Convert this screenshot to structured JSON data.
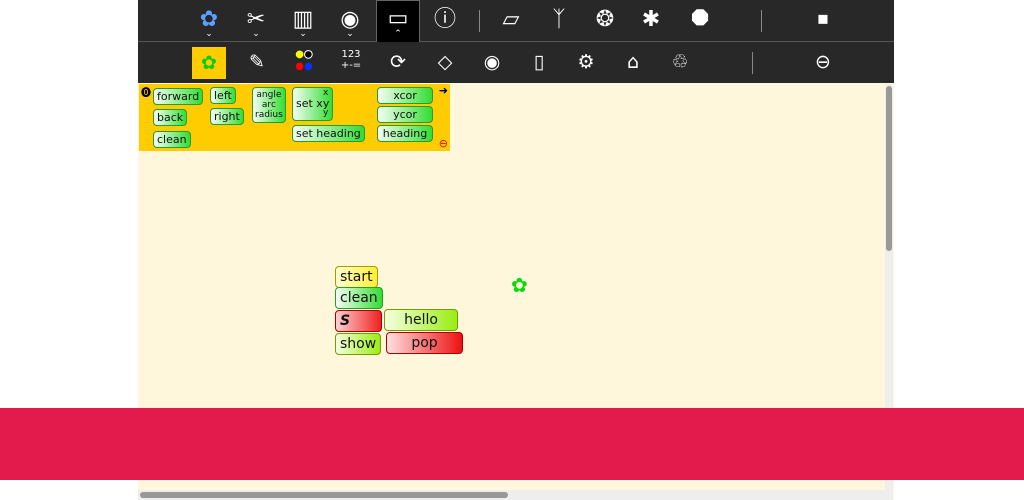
{
  "toolbar": {
    "main": [
      {
        "name": "activity-turtle-icon",
        "glyph": "✿"
      },
      {
        "name": "edit-scissors-icon",
        "glyph": "✂"
      },
      {
        "name": "journal-icon",
        "glyph": "▥"
      },
      {
        "name": "view-eye-icon",
        "glyph": "◉"
      },
      {
        "name": "palette-toggle-icon",
        "glyph": "▭"
      },
      {
        "name": "help-icon",
        "glyph": "?"
      },
      {
        "name": "eraser-icon",
        "glyph": "▱"
      },
      {
        "name": "run-fast-rabbit-icon",
        "glyph": "🐇"
      },
      {
        "name": "run-slow-turtle-icon",
        "glyph": "❂"
      },
      {
        "name": "debug-bug-icon",
        "glyph": "✱"
      },
      {
        "name": "stop-hand-icon",
        "glyph": "✋"
      },
      {
        "name": "stop-activity-icon",
        "glyph": "■"
      }
    ],
    "palettes": [
      {
        "name": "turtle-palette-icon",
        "glyph": "✿"
      },
      {
        "name": "pen-palette-icon",
        "glyph": "✎"
      },
      {
        "name": "colors-palette-icon",
        "glyph": "●"
      },
      {
        "name": "numbers-palette-icon",
        "glyph": "123\n+-="
      },
      {
        "name": "flow-palette-icon",
        "glyph": "⟳"
      },
      {
        "name": "blocks-palette-icon",
        "glyph": "◇"
      },
      {
        "name": "sensors-palette-icon",
        "glyph": "◉"
      },
      {
        "name": "media-palette-icon",
        "glyph": "▯"
      },
      {
        "name": "extras-palette-icon",
        "glyph": "⚙"
      },
      {
        "name": "presentation-palette-icon",
        "glyph": "▭"
      },
      {
        "name": "trash-palette-icon",
        "glyph": "🗑"
      },
      {
        "name": "remove-palette-icon",
        "glyph": "⊖"
      }
    ],
    "numbers_label_top": "123",
    "numbers_label_bottom": "+-="
  },
  "palette_blocks": {
    "forward": "forward",
    "back": "back",
    "clean": "clean",
    "left": "left",
    "right": "right",
    "angle": "angle",
    "arc": "arc",
    "radius": "radius",
    "setxy": "set xy",
    "x": "x",
    "y": "y",
    "setheading": "set heading",
    "xcor": "xcor",
    "ycor": "ycor",
    "heading": "heading"
  },
  "stack": {
    "start": "start",
    "clean": "clean",
    "store": "S",
    "hello": "hello",
    "show": "show",
    "pop": "pop"
  },
  "colors": {
    "banner": "#e31b4d",
    "canvas": "#fff7dc",
    "palette": "#ffcc00",
    "turtle": "#00dd00"
  }
}
